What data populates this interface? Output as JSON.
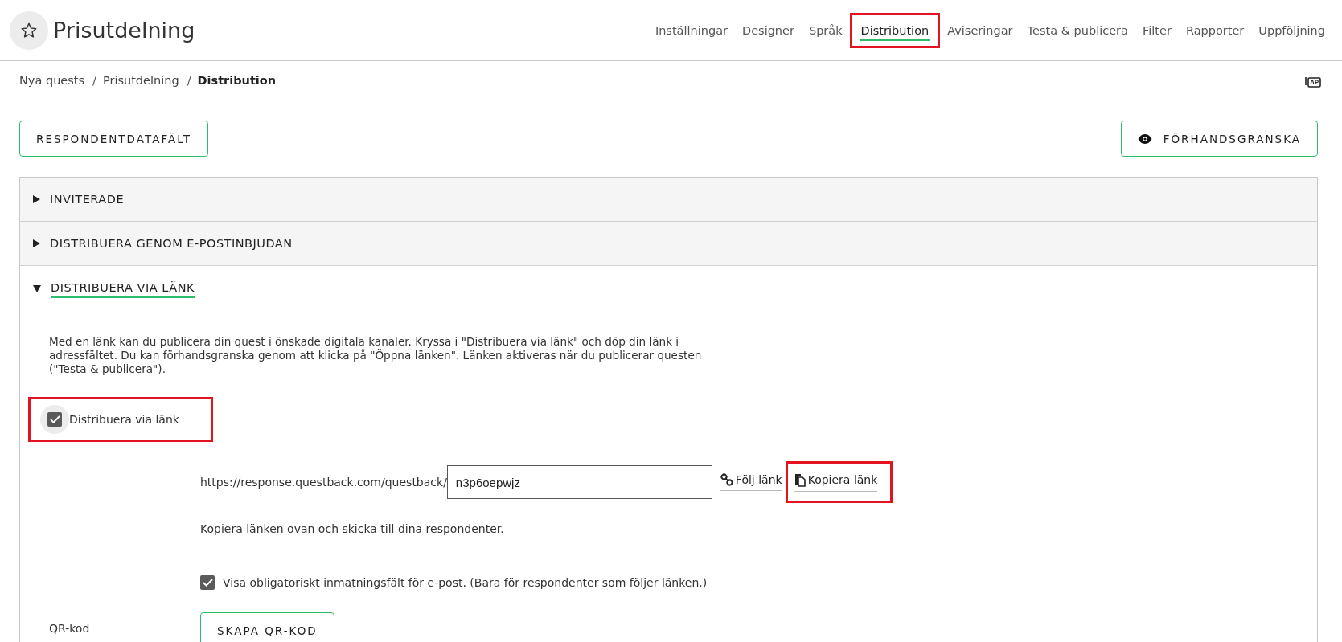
{
  "header": {
    "title": "Prisutdelning",
    "nav": [
      {
        "label": "Inställningar",
        "selected": false,
        "highlighted": false
      },
      {
        "label": "Designer",
        "selected": false,
        "highlighted": false
      },
      {
        "label": "Språk",
        "selected": false,
        "highlighted": false
      },
      {
        "label": "Distribution",
        "selected": true,
        "highlighted": true
      },
      {
        "label": "Aviseringar",
        "selected": false,
        "highlighted": false
      },
      {
        "label": "Testa & publicera",
        "selected": false,
        "highlighted": false
      },
      {
        "label": "Filter",
        "selected": false,
        "highlighted": false
      },
      {
        "label": "Rapporter",
        "selected": false,
        "highlighted": false
      },
      {
        "label": "Uppföljning",
        "selected": false,
        "highlighted": false
      }
    ]
  },
  "breadcrumb": [
    {
      "label": "Nya quests",
      "current": false
    },
    {
      "separator": "/",
      "label": "Prisutdelning",
      "current": false
    },
    {
      "separator": "/",
      "label": "Distribution",
      "current": true
    }
  ],
  "toolbar": {
    "respondent_button": "RESPONDENTDATAFÄLT",
    "preview_button": "FÖRHANDSGRANSKA"
  },
  "sections": [
    {
      "title": "INVITERADE",
      "expanded": false
    },
    {
      "title": "DISTRIBUERA GENOM E-POSTINBJUDAN",
      "expanded": false
    },
    {
      "title": "DISTRIBUERA VIA LÄNK",
      "expanded": true
    }
  ],
  "link_section": {
    "description": "Med en länk kan du publicera din quest i önskade digitala kanaler. Kryssa i \"Distribuera via länk\" och döp din länk i adressfältet. Du kan förhandsgranska genom att klicka på \"Öppna länken\". Länken aktiveras när du publicerar questen (\"Testa & publicera\").",
    "distribute_checkbox": {
      "label": "Distribuera via länk",
      "checked": true,
      "highlighted": true
    },
    "url_prefix": "https://response.questback.com/questback/",
    "slug": "n3p6oepwjz",
    "follow_link": {
      "label": "Följ länk"
    },
    "copy_link": {
      "label": "Kopiera länk",
      "highlighted": true
    },
    "hint": "Kopiera länken ovan och skicka till dina respondenter.",
    "email_checkbox": {
      "label": "Visa obligatoriskt inmatningsfält för e-post. (Bara för respondenter som följer länken.)",
      "checked": true
    },
    "qr_label": "QR-kod",
    "qr_button": "SKAPA QR-KOD"
  }
}
